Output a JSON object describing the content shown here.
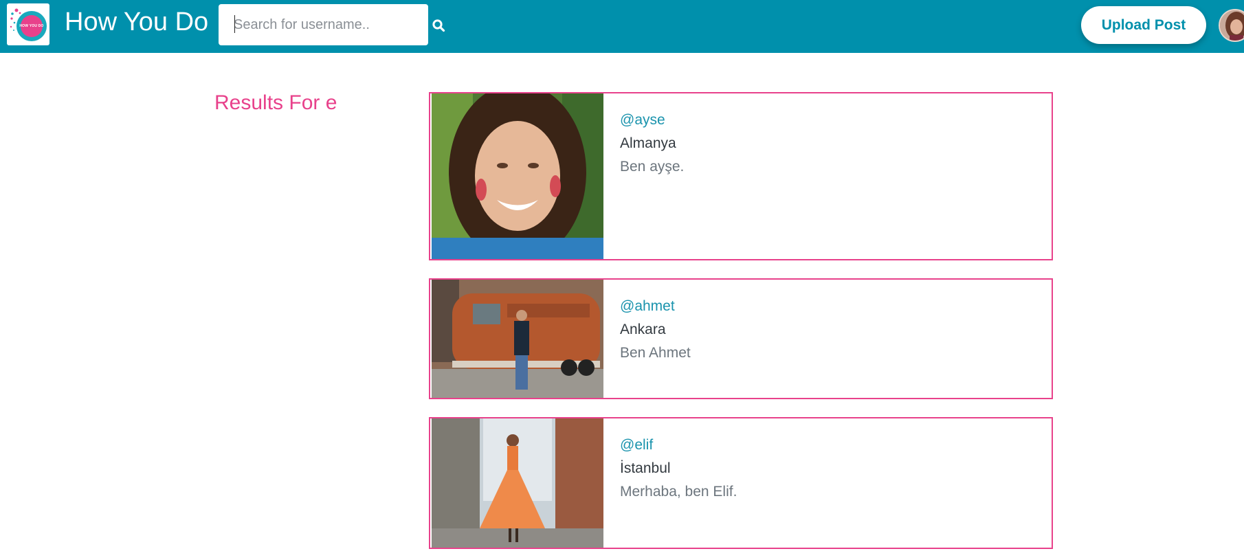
{
  "header": {
    "logo_text": "HOW YOU DO",
    "title": "How You Do",
    "search": {
      "placeholder": "Search for username..",
      "value": ""
    },
    "search_icon": "search-icon",
    "upload_label": "Upload Post",
    "avatar_icon": "user-avatar"
  },
  "colors": {
    "navbar": "#0090ac",
    "accent": "#e8418b",
    "username": "#1a93ad"
  },
  "results": {
    "title": "Results For e",
    "items": [
      {
        "username": "@ayse",
        "location": "Almanya",
        "bio": "Ben ayşe."
      },
      {
        "username": "@ahmet",
        "location": "Ankara",
        "bio": "Ben Ahmet"
      },
      {
        "username": "@elif",
        "location": "İstanbul",
        "bio": "Merhaba, ben Elif."
      }
    ]
  }
}
